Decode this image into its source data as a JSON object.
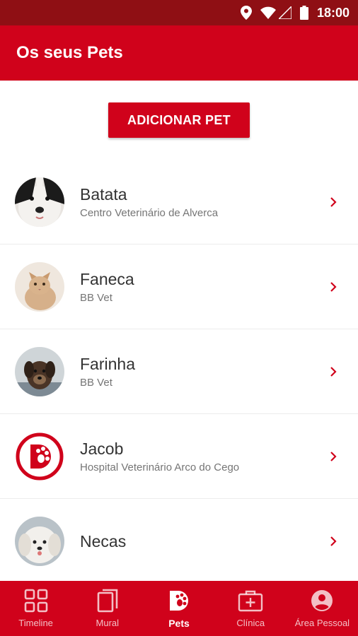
{
  "status_bar": {
    "time": "18:00",
    "icons": [
      "location-icon",
      "wifi-icon",
      "signal-icon",
      "battery-icon"
    ]
  },
  "app_bar": {
    "title": "Os seus Pets"
  },
  "actions": {
    "add_pet_label": "ADICIONAR PET"
  },
  "pets": [
    {
      "name": "Batata",
      "clinic": "Centro Veterinário de Alverca",
      "avatar": "dog-photo"
    },
    {
      "name": "Faneca",
      "clinic": "BB Vet",
      "avatar": "cat-photo"
    },
    {
      "name": "Farinha",
      "clinic": "BB Vet",
      "avatar": "puppy-photo"
    },
    {
      "name": "Jacob",
      "clinic": "Hospital Veterinário Arco do Cego",
      "avatar": "app-logo"
    },
    {
      "name": "Necas",
      "clinic": "",
      "avatar": "white-dog-photo"
    }
  ],
  "bottom_nav": [
    {
      "label": "Timeline",
      "icon": "grid-icon",
      "active": false
    },
    {
      "label": "Mural",
      "icon": "pages-icon",
      "active": false
    },
    {
      "label": "Pets",
      "icon": "paw-logo-icon",
      "active": true
    },
    {
      "label": "Clínica",
      "icon": "medical-kit-icon",
      "active": false
    },
    {
      "label": "Área Pessoal",
      "icon": "account-icon",
      "active": false
    }
  ],
  "colors": {
    "primary": "#d0021b",
    "status_bar": "#8f0f14",
    "text": "#333333",
    "subtext": "#757575"
  }
}
